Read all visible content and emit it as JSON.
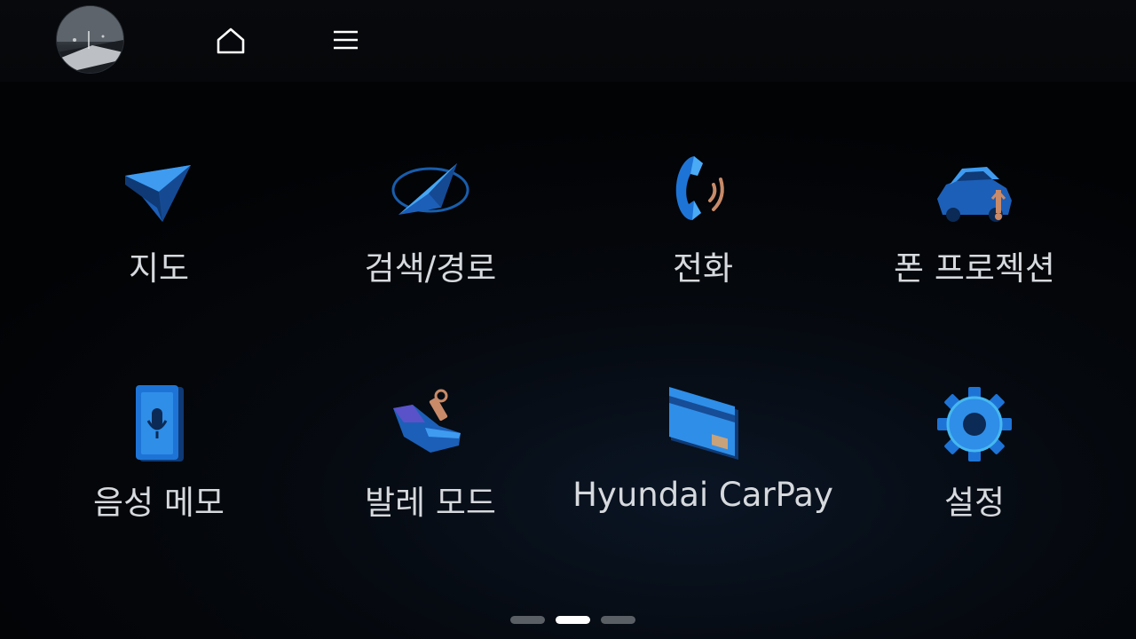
{
  "topbar": {
    "avatar_icon": "road-photo-avatar",
    "home_icon": "home-icon",
    "menu_icon": "hamburger-menu-icon"
  },
  "apps": [
    {
      "label": "지도",
      "icon": "navigation-arrow-icon"
    },
    {
      "label": "검색/경로",
      "icon": "route-search-icon"
    },
    {
      "label": "전화",
      "icon": "phone-handset-icon"
    },
    {
      "label": "폰 프로젝션",
      "icon": "car-usb-icon"
    },
    {
      "label": "음성 메모",
      "icon": "voice-memo-mic-icon"
    },
    {
      "label": "발레 모드",
      "icon": "valet-hand-key-icon"
    },
    {
      "label": "Hyundai CarPay",
      "icon": "payment-card-icon"
    },
    {
      "label": "설정",
      "icon": "settings-gear-icon"
    }
  ],
  "pagination": {
    "pages": 3,
    "current": 2
  },
  "colors": {
    "accent_blue": "#1e74d6",
    "label": "#d6d9dd",
    "background": "#020305"
  }
}
